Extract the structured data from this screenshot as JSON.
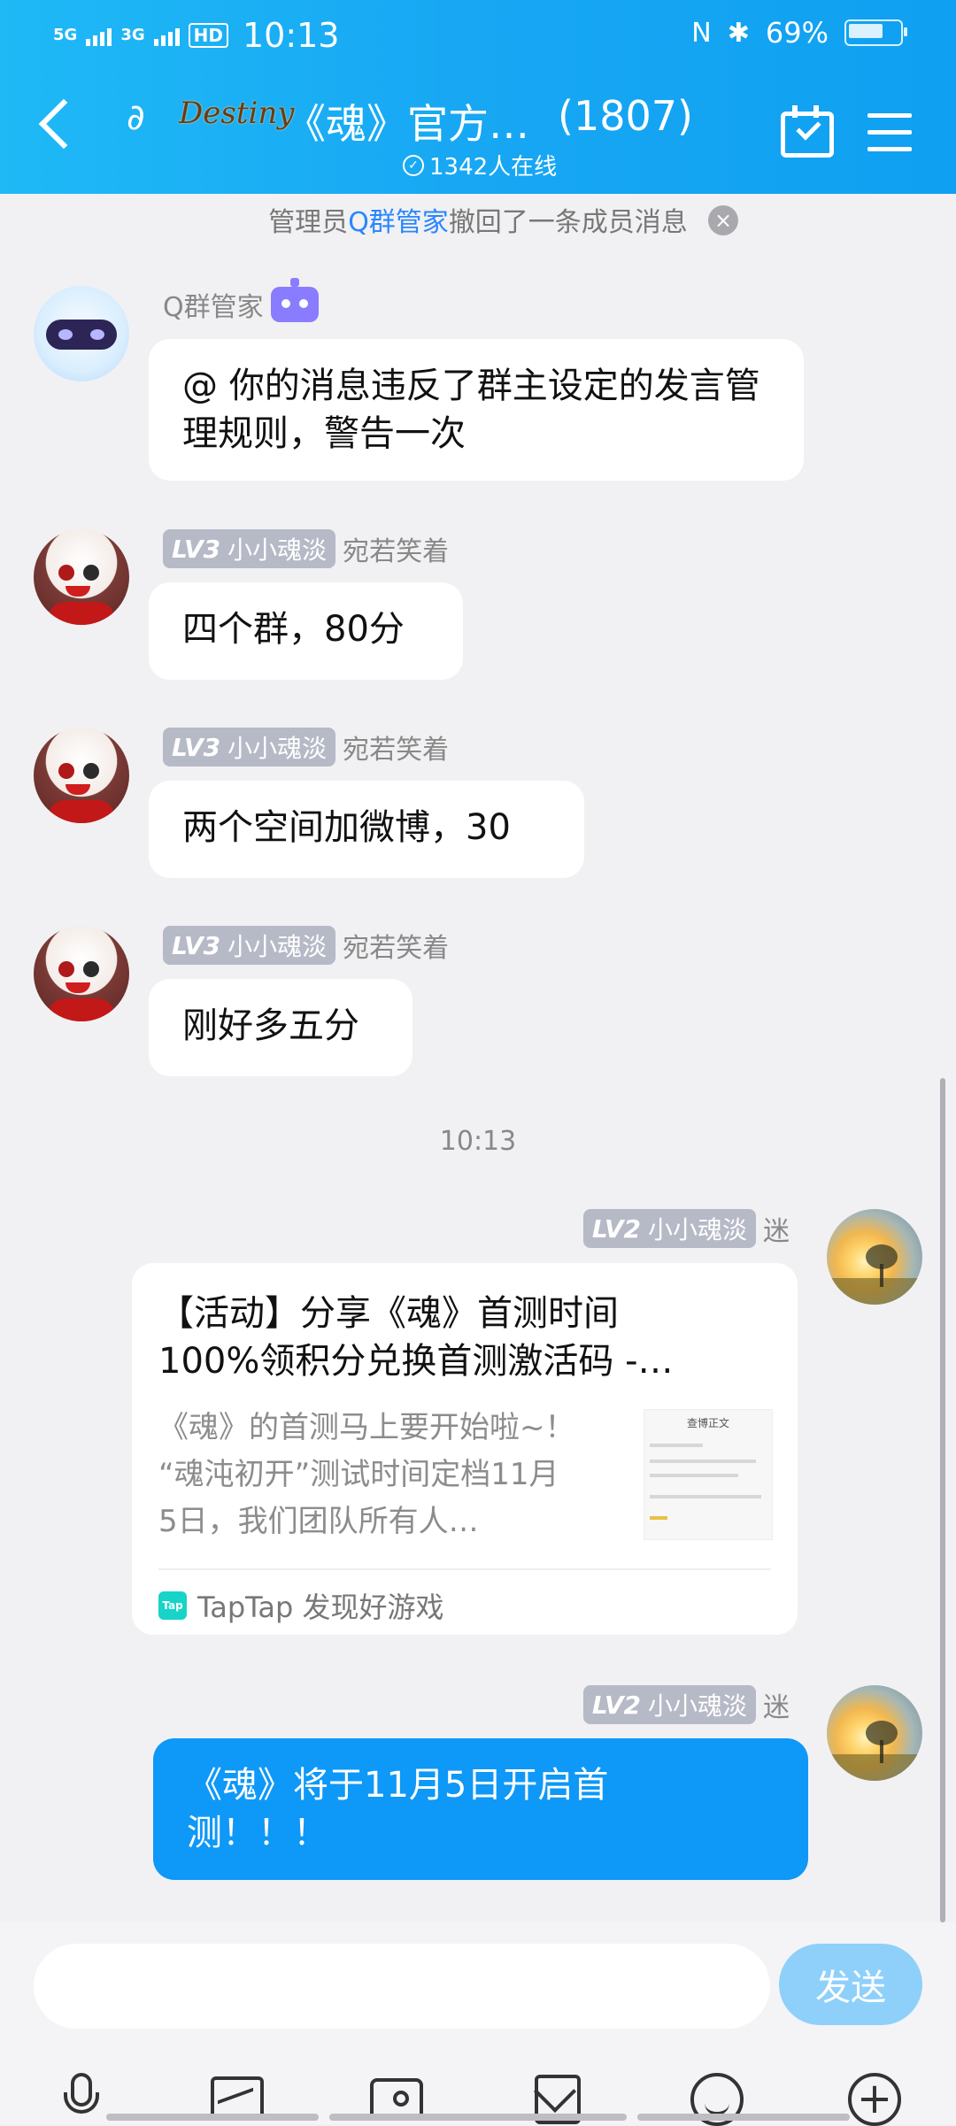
{
  "status_bar": {
    "net1": "5G",
    "net2": "3G",
    "hd": "HD",
    "time": "10:13",
    "battery": "69%"
  },
  "header": {
    "logo_text": "Destiny",
    "title": "《魂》官方…",
    "member_count": "(1807)",
    "online": "1342人在线"
  },
  "notice": {
    "prefix": "管理员",
    "link": "Q群管家",
    "suffix": "撤回了一条成员消息",
    "close": "×"
  },
  "messages": [
    {
      "name": "Q群管家",
      "text": "@ 你的消息违反了群主设定的发言管理规则，警告一次"
    },
    {
      "level": "LV3",
      "tag": "小小魂淡",
      "name": "宛若笑着",
      "text": "四个群，80分"
    },
    {
      "level": "LV3",
      "tag": "小小魂淡",
      "name": "宛若笑着",
      "text": "两个空间加微博，30"
    },
    {
      "level": "LV3",
      "tag": "小小魂淡",
      "name": "宛若笑着",
      "text": "刚好多五分"
    },
    {
      "level": "LV2",
      "tag": "小小魂淡",
      "name": "迷"
    },
    {
      "level": "LV2",
      "tag": "小小魂淡",
      "name": "迷",
      "text": "《魂》将于11月5日开启首测！！！"
    }
  ],
  "timestamp": "10:13",
  "share_card": {
    "title_line1": "【活动】分享《魂》首测时间",
    "title_line2": "100%领积分兑换首测激活码 -…",
    "desc_line1": "《魂》的首测马上要开始啦~！",
    "desc_line2": "“魂沌初开”测试时间定档11月",
    "desc_line3": "5日，我们团队所有人…",
    "thumb_title": "查博正文",
    "tap_icon": "Tap",
    "source": "TapTap 发现好游戏"
  },
  "input": {
    "placeholder": "",
    "send_label": "发送"
  },
  "colors": {
    "header": "#17a7f3",
    "bubble_self": "#0e98f7",
    "link": "#2a86ff"
  },
  "icons": [
    "back-icon",
    "ear-icon",
    "calendar-check-icon",
    "menu-icon",
    "mic-icon",
    "image-icon",
    "camera-icon",
    "red-packet-icon",
    "emoji-icon",
    "plus-icon"
  ]
}
